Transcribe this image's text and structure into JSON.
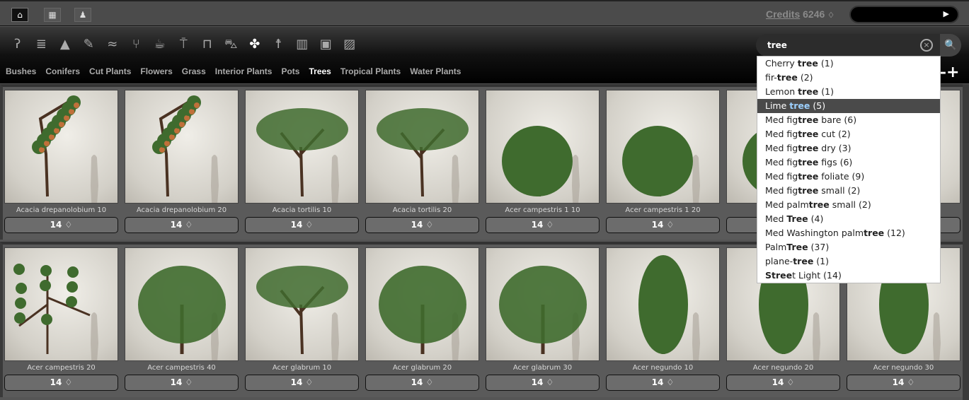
{
  "topbar": {
    "buttons": [
      {
        "name": "home",
        "glyph": "⌂",
        "active": true
      },
      {
        "name": "calendar",
        "glyph": "▦",
        "active": false
      },
      {
        "name": "user",
        "glyph": "♟",
        "active": false
      }
    ],
    "credits_label": "Credits",
    "credits_value": "6246",
    "gem_glyph": "♢",
    "play_glyph": "▶"
  },
  "toolbar": {
    "icons": [
      {
        "name": "paint-roller",
        "glyph": "ʔ"
      },
      {
        "name": "brick-wall",
        "glyph": "≣"
      },
      {
        "name": "floor-tiles",
        "glyph": "▲"
      },
      {
        "name": "trowel",
        "glyph": "✎"
      },
      {
        "name": "water",
        "glyph": "≈"
      },
      {
        "name": "sofa",
        "glyph": "⑂"
      },
      {
        "name": "cup",
        "glyph": "☕"
      },
      {
        "name": "lamp",
        "glyph": "⍑"
      },
      {
        "name": "desk",
        "glyph": "⊓"
      },
      {
        "name": "car",
        "glyph": "⛍"
      },
      {
        "name": "maple-leaf",
        "glyph": "✤",
        "active": true
      },
      {
        "name": "person",
        "glyph": "☨"
      },
      {
        "name": "buildings",
        "glyph": "▥"
      },
      {
        "name": "billboard",
        "glyph": "▣"
      },
      {
        "name": "image",
        "glyph": "▨"
      }
    ],
    "categories": [
      "Bushes",
      "Conifers",
      "Cut Plants",
      "Flowers",
      "Grass",
      "Interior Plants",
      "Pots",
      "Trees",
      "Tropical Plants",
      "Water Plants"
    ],
    "active_category": "Trees"
  },
  "search": {
    "value": "tree",
    "clear_glyph": "×",
    "search_glyph": "🔍"
  },
  "zoom_controls": {
    "minus": "–",
    "plus": "+"
  },
  "dropdown": [
    {
      "pre": "Cherry ",
      "match": "tree",
      "post": "",
      "count": " (1)"
    },
    {
      "pre": "fir-",
      "match": "tree",
      "post": "",
      "count": " (2)"
    },
    {
      "pre": "Lemon ",
      "match": "tree",
      "post": "",
      "count": " (1)"
    },
    {
      "pre": "Lime ",
      "match": "tree",
      "post": "",
      "count": " (5)",
      "highlighted": true
    },
    {
      "pre": "Med fig",
      "match": "tree",
      "post": " bare",
      "count": " (6)"
    },
    {
      "pre": "Med fig",
      "match": "tree",
      "post": " cut",
      "count": " (2)"
    },
    {
      "pre": "Med fig",
      "match": "tree",
      "post": " dry",
      "count": " (3)"
    },
    {
      "pre": "Med fig",
      "match": "tree",
      "post": " figs",
      "count": " (6)"
    },
    {
      "pre": "Med fig",
      "match": "tree",
      "post": " foliate",
      "count": " (9)"
    },
    {
      "pre": "Med fig",
      "match": "tree",
      "post": " small",
      "count": " (2)"
    },
    {
      "pre": "Med palm",
      "match": "tree",
      "post": " small",
      "count": " (2)"
    },
    {
      "pre": "Med ",
      "match": "Tree",
      "post": "",
      "count": " (4)"
    },
    {
      "pre": "Med Washington palm",
      "match": "tree",
      "post": "",
      "count": " (12)"
    },
    {
      "pre": "Palm",
      "match": "Tree",
      "post": "",
      "count": " (37)"
    },
    {
      "pre": "plane-",
      "match": "tree",
      "post": "",
      "count": " (1)"
    },
    {
      "pre": "",
      "match": "Stree",
      "post": "t Light",
      "count": " (14)"
    }
  ],
  "rows": [
    [
      {
        "label": "Acacia drepanolobium 10",
        "price": "14",
        "kind": "palm"
      },
      {
        "label": "Acacia drepanolobium 20",
        "price": "14",
        "kind": "palm"
      },
      {
        "label": "Acacia tortilis 10",
        "price": "14",
        "kind": "umbrella"
      },
      {
        "label": "Acacia tortilis 20",
        "price": "14",
        "kind": "umbrella"
      },
      {
        "label": "Acer campestris 1 10",
        "price": "14",
        "kind": "bush"
      },
      {
        "label": "Acer campestris 1 20",
        "price": "14",
        "kind": "bush"
      },
      {
        "label": "Ac",
        "price": "",
        "kind": "bush"
      },
      {
        "label": "",
        "price": "",
        "kind": "tall"
      }
    ],
    [
      {
        "label": "Acer campestris 20",
        "price": "14",
        "kind": "sparse"
      },
      {
        "label": "Acer campestris 40",
        "price": "14",
        "kind": "round"
      },
      {
        "label": "Acer glabrum 10",
        "price": "14",
        "kind": "umbrella"
      },
      {
        "label": "Acer glabrum 20",
        "price": "14",
        "kind": "round"
      },
      {
        "label": "Acer glabrum 30",
        "price": "14",
        "kind": "round"
      },
      {
        "label": "Acer negundo 10",
        "price": "14",
        "kind": "tall"
      },
      {
        "label": "Acer negundo 20",
        "price": "14",
        "kind": "tall"
      },
      {
        "label": "Acer negundo 30",
        "price": "14",
        "kind": "tall"
      }
    ]
  ],
  "colors": {
    "accent_highlight": "#9cd0ff",
    "foliage": "#3f6b2e",
    "trunk": "#4a3222"
  }
}
